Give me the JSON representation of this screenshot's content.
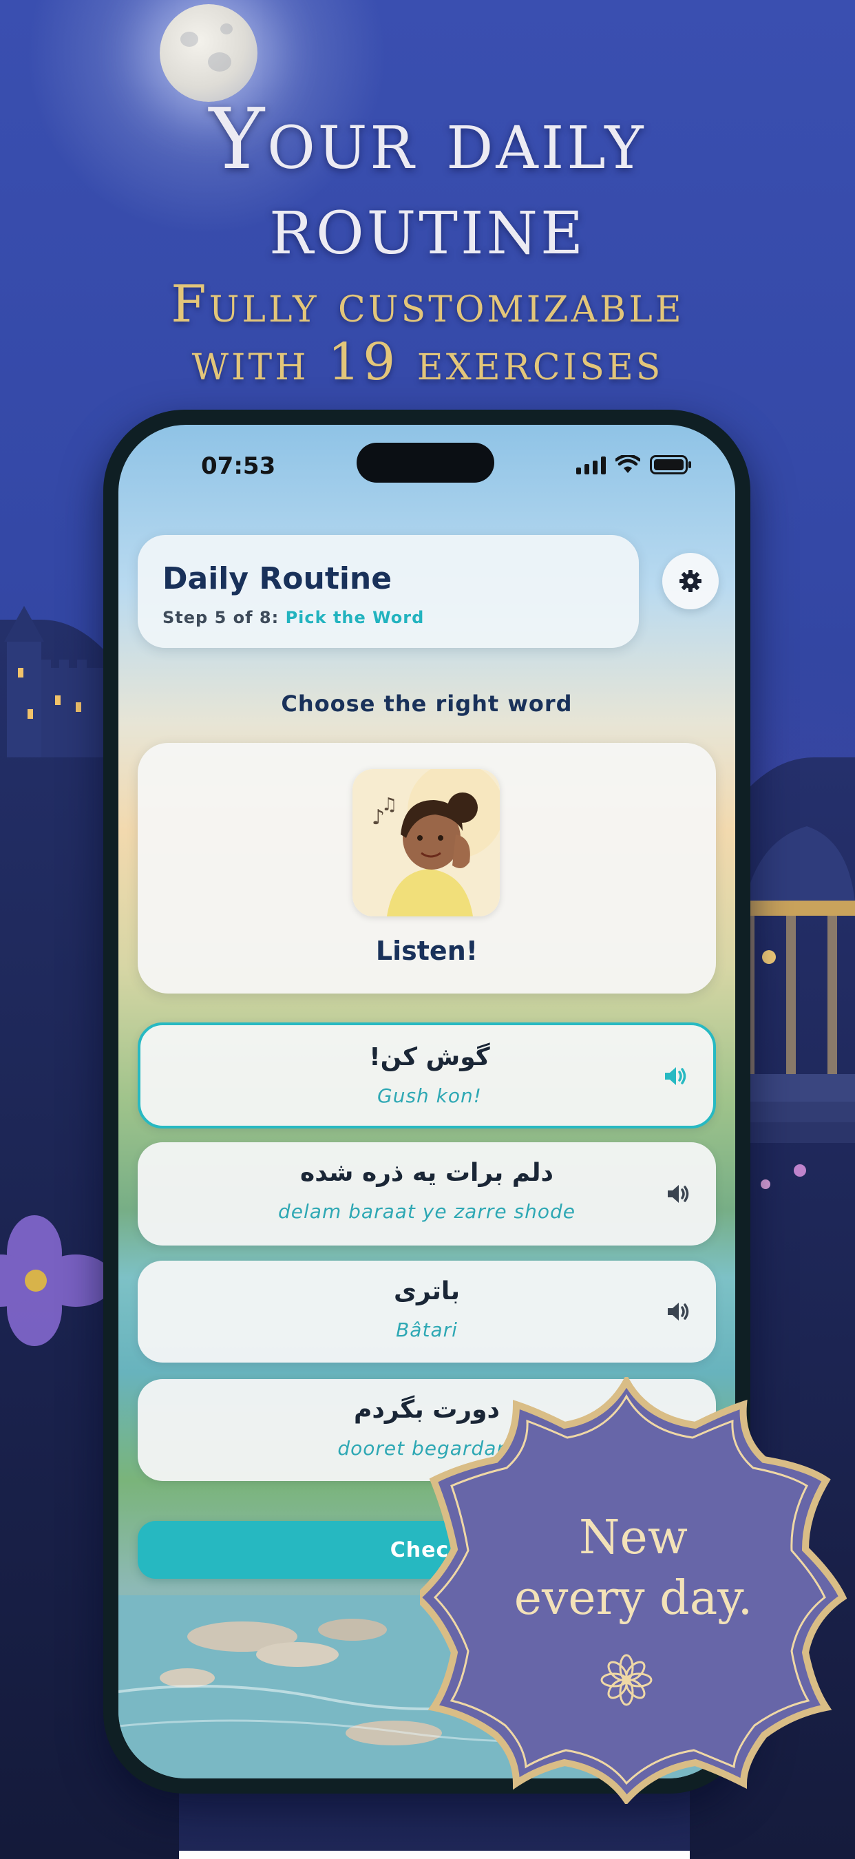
{
  "headline": {
    "line1": "Your daily",
    "line2": "routine",
    "line3": "Fully customizable",
    "line4": "with 19 exercises"
  },
  "status_bar": {
    "time": "07:53",
    "icons": [
      "signal-icon",
      "wifi-icon",
      "battery-icon"
    ]
  },
  "header": {
    "title": "Daily Routine",
    "step_prefix": "Step 5 of 8:",
    "step_name": "Pick the Word",
    "settings_icon": "gear-icon"
  },
  "exercise": {
    "prompt": "Choose the right word",
    "card_label": "Listen!",
    "card_image": "girl-listening-illustration"
  },
  "options": [
    {
      "persian": "گوش کن!",
      "transliteration": "Gush kon!",
      "selected": true
    },
    {
      "persian": "دلم برات یه ذره شده",
      "transliteration": "delam baraat ye zarre shode",
      "selected": false
    },
    {
      "persian": "باتری",
      "transliteration": "Bâtari",
      "selected": false
    },
    {
      "persian": "دورت بگردم",
      "transliteration": "dooret begardam",
      "selected": false
    }
  ],
  "check_button": {
    "label": "Check"
  },
  "badge": {
    "line1": "New",
    "line2": "every day.",
    "icon": "flower-ornament-icon"
  },
  "colors": {
    "accent": "#26b8c1",
    "navy_text": "#19315a",
    "badge_fill": "#6766a8",
    "badge_border": "#d9bd86",
    "headline_gold": "#e3c67a"
  }
}
